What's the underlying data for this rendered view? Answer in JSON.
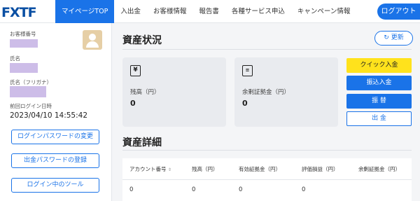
{
  "header": {
    "logo": "FXTF",
    "nav": [
      "マイページTOP",
      "入出金",
      "お客様情報",
      "報告書",
      "各種サービス申込",
      "キャンペーン情報"
    ],
    "logout_label": "ログアウト"
  },
  "sidebar": {
    "customer_number_label": "お客様番号",
    "name_label": "氏名",
    "name_kana_label": "氏名（フリガナ）",
    "last_login_label": "前回ログイン日時",
    "last_login_value": "2023/04/10 14:55:42",
    "buttons": [
      "ログインパスワードの変更",
      "出金パスワードの登録",
      "ログイン中のツール"
    ]
  },
  "main": {
    "title": "資産状況",
    "refresh_label": "更新",
    "cards": [
      {
        "icon": "yen-icon",
        "label": "残高（円）",
        "value": "0"
      },
      {
        "icon": "document-check-icon",
        "label": "余剰証拠金（円）",
        "value": "0"
      }
    ],
    "actions": [
      {
        "label": "クイック入金",
        "color": "#ffe21c"
      },
      {
        "label": "振込入金",
        "color": "#1a73e8"
      },
      {
        "label": "振 替",
        "color": "#1a73e8"
      },
      {
        "label": "出 金",
        "color": "#ffffff"
      }
    ],
    "detail_title": "資産詳細",
    "table": {
      "headers": [
        "アカウント番号",
        "残高（円）",
        "有効証拠金（円）",
        "評価損益（円）",
        "余剰証拠金（円）"
      ],
      "rows": [
        [
          "0",
          "0",
          "0",
          "0",
          ""
        ]
      ]
    }
  }
}
